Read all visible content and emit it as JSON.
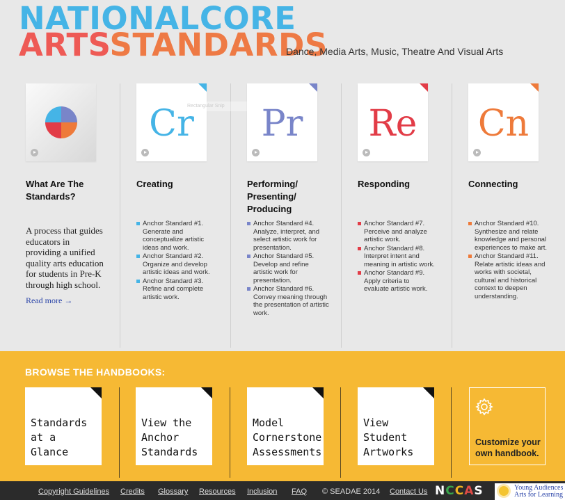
{
  "header": {
    "logo_line1_a": "NATIONAL",
    "logo_line1_b": "CORE",
    "logo_line2_a": "ARTS",
    "logo_line2_b": "STANDARDS",
    "tagline": "Dance, Media Arts, Music, Theatre And Visual Arts"
  },
  "colors": {
    "creating": "#45b4e6",
    "performing": "#7985c9",
    "responding": "#e23c47",
    "connecting": "#ee7a3a",
    "browse_bg": "#f6b934"
  },
  "intro": {
    "title": "What Are The Standards?",
    "description": "A process that guides educators in providing a unified quality arts education for students in Pre-K through high school.",
    "read_more": "Read more →"
  },
  "ghost_label": "Rectangular Snip",
  "processes": [
    {
      "abbr": "Cr",
      "title": "Creating",
      "anchors": [
        "Anchor Standard #1. Generate and conceptualize artistic ideas and work.",
        "Anchor Standard #2. Organize and develop artistic ideas and work.",
        "Anchor Standard #3. Refine and complete artistic work."
      ]
    },
    {
      "abbr": "Pr",
      "title": "Performing/ Presenting/ Producing",
      "anchors": [
        "Anchor Standard #4. Analyze, interpret, and select artistic work for presentation.",
        "Anchor Standard #5. Develop and refine artistic work for presentation.",
        "Anchor Standard #6. Convey meaning through the presentation of artistic work."
      ]
    },
    {
      "abbr": "Re",
      "title": "Responding",
      "anchors": [
        "Anchor Standard #7. Perceive and analyze artistic work.",
        "Anchor Standard #8. Interpret intent and meaning in artistic work.",
        "Anchor Standard #9. Apply criteria to evaluate artistic work."
      ]
    },
    {
      "abbr": "Cn",
      "title": "Connecting",
      "anchors": [
        "Anchor Standard #10. Synthesize and relate knowledge and personal experiences to make art.",
        "Anchor Standard #11. Relate artistic ideas and works with societal, cultural and historical context to deepen understanding."
      ]
    }
  ],
  "browse": {
    "title": "BROWSE THE HANDBOOKS:",
    "handbooks": [
      "Standards at a Glance",
      "View the Anchor Standards",
      "Model Cornerstone Assessments",
      "View Student Artworks"
    ],
    "customize": "Customize your own handbook."
  },
  "footer": {
    "links": [
      "Copyright Guidelines",
      "Credits",
      "Glossary",
      "Resources",
      "Inclusion",
      "FAQ",
      "© SEADAE 2014",
      "Contact Us"
    ],
    "ncas": "NCCAS",
    "partner_line1": "Young Audiences",
    "partner_line2": "Arts for Learning"
  }
}
